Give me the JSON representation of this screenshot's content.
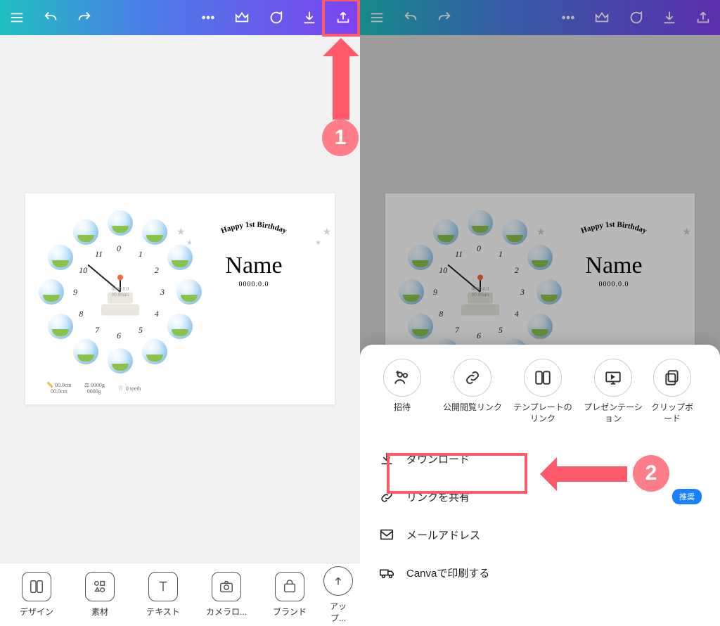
{
  "annotations": {
    "step1": "1",
    "step2": "2"
  },
  "design": {
    "arc_text": "Happy 1st Birthday",
    "name": "Name",
    "date": "0000.0.0",
    "clock_numbers": [
      "0",
      "1",
      "2",
      "3",
      "4",
      "5",
      "6",
      "7",
      "8",
      "9",
      "10",
      "11"
    ],
    "center_line1": "0000.0.0",
    "center_line2": "00:00am",
    "measure_height": "00.0cm",
    "measure_height2": "00.0cm",
    "measure_weight": "0000g",
    "measure_weight2": "0000g",
    "measure_teeth": "0 teeth"
  },
  "bottom_nav": [
    {
      "label": "デザイン"
    },
    {
      "label": "素材"
    },
    {
      "label": "テキスト"
    },
    {
      "label": "カメラロ..."
    },
    {
      "label": "ブランド"
    },
    {
      "label": "アップ..."
    }
  ],
  "sheet_actions": [
    {
      "label": "招待"
    },
    {
      "label": "公開閲覧リンク"
    },
    {
      "label": "テンプレートのリンク"
    },
    {
      "label": "プレゼンテーション"
    },
    {
      "label": "クリップボード"
    }
  ],
  "sheet_list": {
    "download": "ダウンロード",
    "share_link": "リンクを共有",
    "recommended": "推奨",
    "email": "メールアドレス",
    "print": "Canvaで印刷する"
  }
}
